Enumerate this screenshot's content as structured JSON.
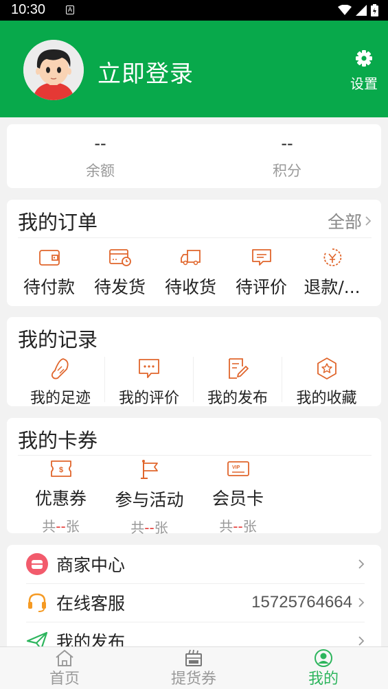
{
  "status_bar": {
    "time": "10:30",
    "notif_glyph": "A"
  },
  "header": {
    "login_label": "立即登录",
    "settings_label": "设置"
  },
  "stats": [
    {
      "value": "--",
      "label": "余额"
    },
    {
      "value": "--",
      "label": "积分"
    }
  ],
  "orders": {
    "title": "我的订单",
    "all_label": "全部",
    "items": [
      {
        "label": "待付款",
        "icon": "wallet-icon"
      },
      {
        "label": "待发货",
        "icon": "card-clock-icon"
      },
      {
        "label": "待收货",
        "icon": "truck-icon"
      },
      {
        "label": "待评价",
        "icon": "comment-icon"
      },
      {
        "label": "退款/...",
        "icon": "refund-icon"
      }
    ]
  },
  "records": {
    "title": "我的记录",
    "items": [
      {
        "label": "我的足迹",
        "icon": "footprint-icon"
      },
      {
        "label": "我的评价",
        "icon": "chat-icon"
      },
      {
        "label": "我的发布",
        "icon": "edit-icon"
      },
      {
        "label": "我的收藏",
        "icon": "star-icon"
      }
    ]
  },
  "coupons": {
    "title": "我的卡券",
    "items": [
      {
        "label": "优惠券",
        "count_prefix": "共",
        "count": "--",
        "count_suffix": "张",
        "icon": "coupon-icon"
      },
      {
        "label": "参与活动",
        "count_prefix": "共",
        "count": "--",
        "count_suffix": "张",
        "icon": "flag-icon"
      },
      {
        "label": "会员卡",
        "count_prefix": "共",
        "count": "--",
        "count_suffix": "张",
        "icon": "vip-card-icon"
      }
    ],
    "vip_text": "VIP"
  },
  "menu": [
    {
      "label": "商家中心",
      "value": "",
      "icon": "store-icon"
    },
    {
      "label": "在线客服",
      "value": "15725764664",
      "icon": "headset-icon"
    },
    {
      "label": "我的发布",
      "value": "",
      "icon": "send-icon"
    }
  ],
  "tabbar": [
    {
      "label": "首页",
      "icon": "home-icon",
      "active": false
    },
    {
      "label": "提货券",
      "icon": "ticket-icon",
      "active": false
    },
    {
      "label": "我的",
      "icon": "profile-icon",
      "active": true
    }
  ],
  "colors": {
    "brand_green": "#08a94b",
    "accent_orange": "#e0652b",
    "tab_inactive": "#999999"
  }
}
